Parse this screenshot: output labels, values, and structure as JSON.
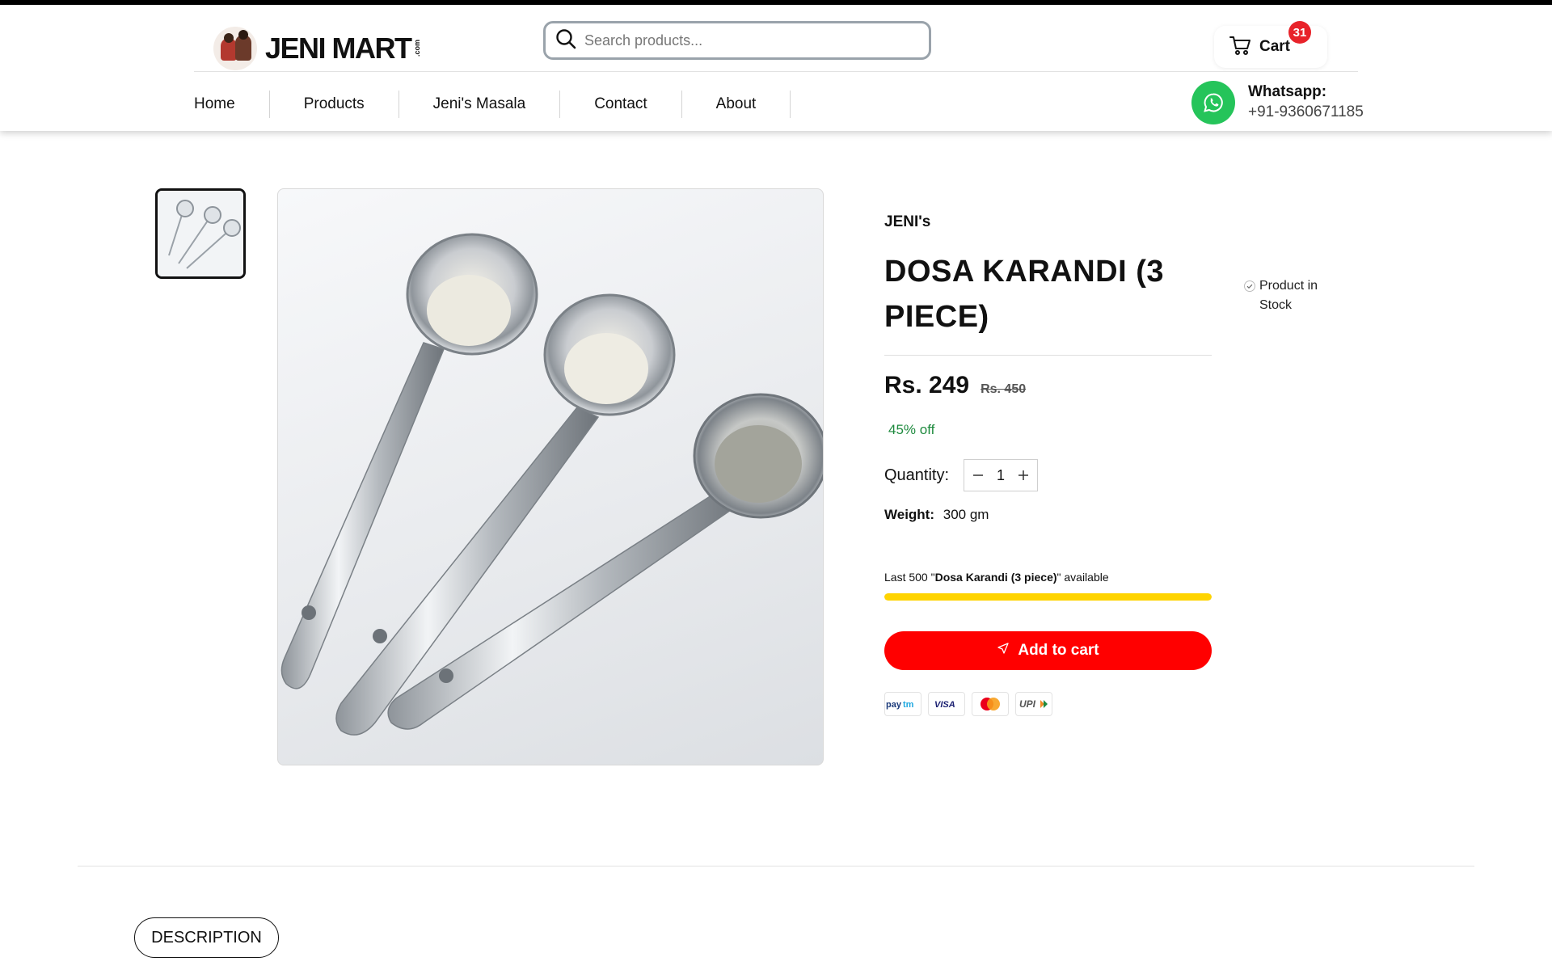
{
  "header": {
    "logo_text": "JENI MART",
    "logo_suffix": ".com",
    "search_placeholder": "Search products...",
    "cart_label": "Cart",
    "cart_count": "31"
  },
  "nav": {
    "items": [
      {
        "label": "Home"
      },
      {
        "label": "Products"
      },
      {
        "label": "Jeni's Masala"
      },
      {
        "label": "Contact"
      },
      {
        "label": "About"
      }
    ]
  },
  "whatsapp": {
    "title": "Whatsapp:",
    "number": "+91-9360671185"
  },
  "product": {
    "brand": "JENI's",
    "title": "DOSA KARANDI (3 PIECE)",
    "stock_status": "Product in Stock",
    "price": "Rs. 249",
    "mrp": "Rs. 450",
    "discount": "45% off",
    "quantity_label": "Quantity:",
    "quantity": "1",
    "weight_label": "Weight:",
    "weight": "300 gm",
    "availability_prefix": "Last 500 \"",
    "availability_name": "Dosa Karandi (3 piece)",
    "availability_suffix": "\" available",
    "availability_fill_fraction": 1.0,
    "add_to_cart_label": "Add to cart"
  },
  "payments": [
    "Paytm",
    "VISA",
    "Mastercard",
    "UPI"
  ],
  "tabs": {
    "description_label": "DESCRIPTION"
  },
  "colors": {
    "accent_red": "#ff0000",
    "cart_badge": "#e8232a",
    "whatsapp_green": "#25c45a",
    "progress_yellow": "#ffd400",
    "discount_green": "#1e8a3e"
  },
  "icons": {
    "search": "search-icon",
    "cart": "cart-icon",
    "whatsapp": "whatsapp-icon",
    "stock": "check-circle-icon",
    "add_to_cart": "send-icon"
  }
}
